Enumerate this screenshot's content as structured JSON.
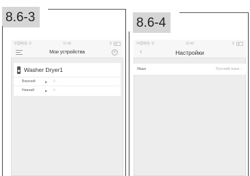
{
  "figures": [
    {
      "label": "8.6-3"
    },
    {
      "label": "8.6-4"
    }
  ],
  "screen1": {
    "status": {
      "carrier": "中国电信 令",
      "time": "11:46",
      "indicators": "令"
    },
    "nav": {
      "title": "Мои устройства",
      "menu_icon": "hamburger-menu-icon",
      "add_icon": "plus-circle-icon"
    },
    "device": {
      "name": "Washer Dryer1",
      "icon": "washer-icon",
      "rows": [
        {
          "name": "Верхний",
          "value": "-/-"
        },
        {
          "name": "Нижний",
          "value": "-/-"
        }
      ]
    }
  },
  "screen2": {
    "status": {
      "carrier": "中国电信 令",
      "time": "10:46",
      "indicators": "令"
    },
    "nav": {
      "title": "Настройки",
      "back_icon": "chevron-left-icon"
    },
    "settings": {
      "language_label": "Язык",
      "language_value": "Русский язык"
    }
  }
}
